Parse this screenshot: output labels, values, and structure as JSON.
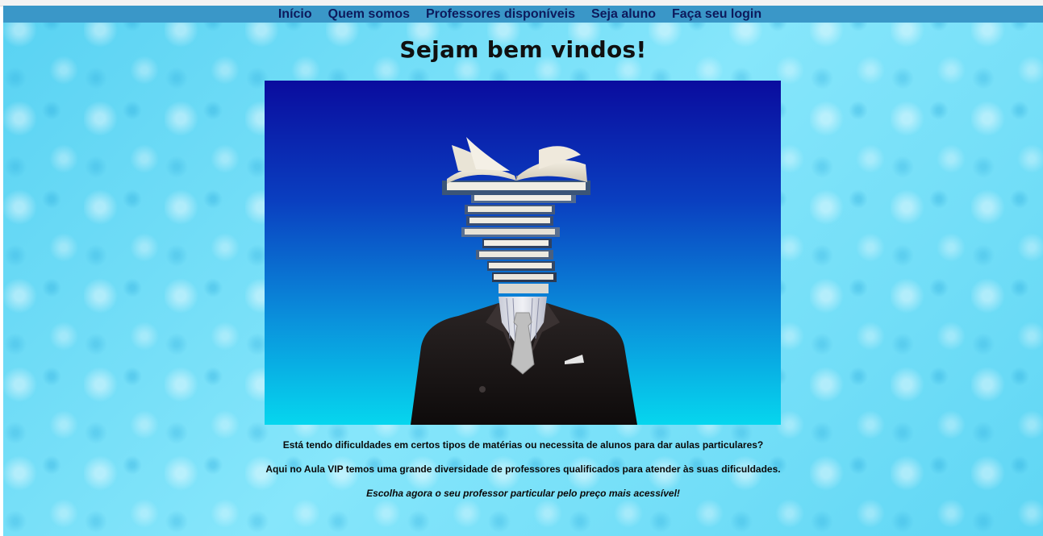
{
  "nav": {
    "items": [
      {
        "label": "Início"
      },
      {
        "label": "Quem somos"
      },
      {
        "label": "Professores disponíveis"
      },
      {
        "label": "Seja aluno"
      },
      {
        "label": "Faça seu login"
      }
    ]
  },
  "main": {
    "title": "Sejam bem vindos!",
    "hero_image": "books-head-businessman-image",
    "paragraphs": [
      "Está tendo dificuldades em certos tipos de matérias ou necessita de alunos para dar aulas particulares?",
      "Aqui no Aula VIP temos uma grande diversidade de professores qualificados para atender às suas dificuldades.",
      "Escolha agora o seu professor particular pelo preço mais acessível!"
    ]
  },
  "colors": {
    "navbar": "#3a97c8",
    "nav_text": "#0d1a5c",
    "page_background": "#6fdcf6",
    "hero_top": "#0a0c9e",
    "hero_bottom": "#06d6ee"
  }
}
